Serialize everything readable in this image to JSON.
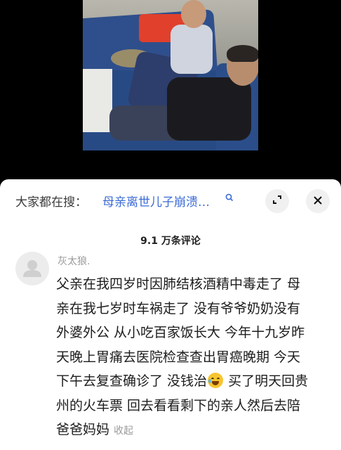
{
  "search": {
    "label": "大家都在搜：",
    "query": "母亲离世儿子崩溃…"
  },
  "comments_header": {
    "count": "9.1 万条评论"
  },
  "comment": {
    "username": "灰太狼.",
    "lines": [
      "父亲在我四岁时因肺结核酒精中毒走了 母",
      "亲在我七岁时车祸走了 没有爷爷奶奶没有",
      "外婆外公 从小吃百家饭长大 今年十九岁昨",
      "天晚上胃痛去医院检查查出胃癌晚期 今天",
      "下午去复查确诊了 没钱治",
      " 买了明天回贵",
      "州的火车票 回去看看剩下的亲人然后去陪",
      "爸爸妈妈"
    ],
    "collapse_label": "收起",
    "emoji": "crying-laughing-face"
  },
  "icons": {
    "search": "search-icon",
    "expand": "expand-icon",
    "close": "close-icon",
    "avatar": "default-avatar-icon"
  },
  "colors": {
    "link": "#3b6bd6",
    "muted": "#9a9a9a",
    "text": "#1c1c1c"
  }
}
